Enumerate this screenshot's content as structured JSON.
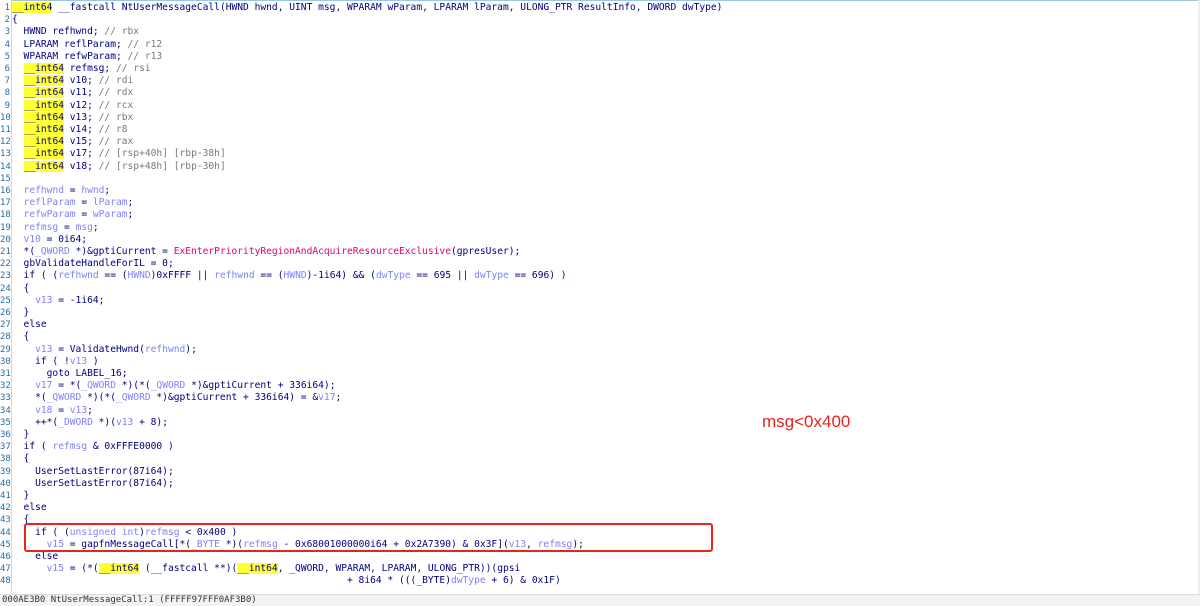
{
  "annotation": "msg<0x400",
  "status_bar": "000AE3B0 NtUserMessageCall:1 (FFFFF97FFF0AF3B0)",
  "lines": [
    {
      "n": "1",
      "seg": [
        [
          "hl",
          "__int64"
        ],
        [
          "kw",
          " __fastcall NtUserMessageCall(HWND hwnd, UINT msg, WPARAM wParam, LPARAM lParam, ULONG_PTR ResultInfo, DWORD dwType)"
        ]
      ]
    },
    {
      "n": "2",
      "seg": [
        [
          "kw",
          "{"
        ]
      ]
    },
    {
      "n": "3",
      "seg": [
        [
          "kw",
          "  HWND refhwnd; "
        ],
        [
          "comment",
          "// rbx"
        ]
      ]
    },
    {
      "n": "4",
      "seg": [
        [
          "kw",
          "  LPARAM reflParam; "
        ],
        [
          "comment",
          "// r12"
        ]
      ]
    },
    {
      "n": "5",
      "seg": [
        [
          "kw",
          "  WPARAM refwParam; "
        ],
        [
          "comment",
          "// r13"
        ]
      ]
    },
    {
      "n": "6",
      "seg": [
        [
          "kw",
          "  "
        ],
        [
          "hl",
          "__int64"
        ],
        [
          "kw",
          " refmsg; "
        ],
        [
          "comment",
          "// rsi"
        ]
      ]
    },
    {
      "n": "7",
      "seg": [
        [
          "kw",
          "  "
        ],
        [
          "hl",
          "__int64"
        ],
        [
          "kw",
          " v10; "
        ],
        [
          "comment",
          "// rdi"
        ]
      ]
    },
    {
      "n": "8",
      "seg": [
        [
          "kw",
          "  "
        ],
        [
          "hl",
          "__int64"
        ],
        [
          "kw",
          " v11; "
        ],
        [
          "comment",
          "// rdx"
        ]
      ]
    },
    {
      "n": "9",
      "seg": [
        [
          "kw",
          "  "
        ],
        [
          "hl",
          "__int64"
        ],
        [
          "kw",
          " v12; "
        ],
        [
          "comment",
          "// rcx"
        ]
      ]
    },
    {
      "n": "10",
      "seg": [
        [
          "kw",
          "  "
        ],
        [
          "hl",
          "__int64"
        ],
        [
          "kw",
          " v13; "
        ],
        [
          "comment",
          "// rbx"
        ]
      ]
    },
    {
      "n": "11",
      "seg": [
        [
          "kw",
          "  "
        ],
        [
          "hl",
          "__int64"
        ],
        [
          "kw",
          " v14; "
        ],
        [
          "comment",
          "// r8"
        ]
      ]
    },
    {
      "n": "12",
      "seg": [
        [
          "kw",
          "  "
        ],
        [
          "hl",
          "__int64"
        ],
        [
          "kw",
          " v15; "
        ],
        [
          "comment",
          "// rax"
        ]
      ]
    },
    {
      "n": "13",
      "seg": [
        [
          "kw",
          "  "
        ],
        [
          "hl",
          "__int64"
        ],
        [
          "kw",
          " v17; "
        ],
        [
          "comment",
          "// [rsp+40h] [rbp-38h]"
        ]
      ]
    },
    {
      "n": "14",
      "seg": [
        [
          "kw",
          "  "
        ],
        [
          "hl",
          "__int64"
        ],
        [
          "kw",
          " v18; "
        ],
        [
          "comment",
          "// [rsp+48h] [rbp-30h]"
        ]
      ]
    },
    {
      "n": "15",
      "seg": []
    },
    {
      "n": "16",
      "seg": [
        [
          "var",
          "  refhwnd"
        ],
        [
          "kw",
          " = "
        ],
        [
          "var",
          "hwnd"
        ],
        [
          "kw",
          ";"
        ]
      ]
    },
    {
      "n": "17",
      "seg": [
        [
          "var",
          "  reflParam"
        ],
        [
          "kw",
          " = "
        ],
        [
          "var",
          "lParam"
        ],
        [
          "kw",
          ";"
        ]
      ]
    },
    {
      "n": "18",
      "seg": [
        [
          "var",
          "  refwParam"
        ],
        [
          "kw",
          " = "
        ],
        [
          "var",
          "wParam"
        ],
        [
          "kw",
          ";"
        ]
      ]
    },
    {
      "n": "19",
      "seg": [
        [
          "var",
          "  refmsg"
        ],
        [
          "kw",
          " = "
        ],
        [
          "var",
          "msg"
        ],
        [
          "kw",
          ";"
        ]
      ]
    },
    {
      "n": "20",
      "seg": [
        [
          "var",
          "  v10"
        ],
        [
          "kw",
          " = 0i64;"
        ]
      ]
    },
    {
      "n": "21",
      "seg": [
        [
          "kw",
          "  *("
        ],
        [
          "var",
          "_QWORD"
        ],
        [
          "kw",
          " *)&gptiCurrent = "
        ],
        [
          "func",
          "ExEnterPriorityRegionAndAcquireResourceExclusive"
        ],
        [
          "kw",
          "(gpresUser);"
        ]
      ]
    },
    {
      "n": "22",
      "seg": [
        [
          "kw",
          "  gbValidateHandleForIL = 0;"
        ]
      ]
    },
    {
      "n": "23",
      "seg": [
        [
          "kw",
          "  if ( ("
        ],
        [
          "var",
          "refhwnd"
        ],
        [
          "kw",
          " == ("
        ],
        [
          "var",
          "HWND"
        ],
        [
          "kw",
          ")0xFFFF || "
        ],
        [
          "var",
          "refhwnd"
        ],
        [
          "kw",
          " == ("
        ],
        [
          "var",
          "HWND"
        ],
        [
          "kw",
          ")-1i64) && ("
        ],
        [
          "var",
          "dwType"
        ],
        [
          "kw",
          " == 695 || "
        ],
        [
          "var",
          "dwType"
        ],
        [
          "kw",
          " == 696) )"
        ]
      ]
    },
    {
      "n": "24",
      "seg": [
        [
          "kw",
          "  {"
        ]
      ]
    },
    {
      "n": "25",
      "seg": [
        [
          "var",
          "    v13"
        ],
        [
          "kw",
          " = -1i64;"
        ]
      ]
    },
    {
      "n": "26",
      "seg": [
        [
          "kw",
          "  }"
        ]
      ]
    },
    {
      "n": "27",
      "seg": [
        [
          "kw",
          "  else"
        ]
      ]
    },
    {
      "n": "28",
      "seg": [
        [
          "kw",
          "  {"
        ]
      ]
    },
    {
      "n": "29",
      "seg": [
        [
          "var",
          "    v13"
        ],
        [
          "kw",
          " = ValidateHwnd("
        ],
        [
          "var",
          "refhwnd"
        ],
        [
          "kw",
          ");"
        ]
      ]
    },
    {
      "n": "30",
      "seg": [
        [
          "kw",
          "    if ( !"
        ],
        [
          "var",
          "v13"
        ],
        [
          "kw",
          " )"
        ]
      ]
    },
    {
      "n": "31",
      "seg": [
        [
          "kw",
          "      goto LABEL_16;"
        ]
      ]
    },
    {
      "n": "32",
      "seg": [
        [
          "var",
          "    v17"
        ],
        [
          "kw",
          " = *("
        ],
        [
          "var",
          "_QWORD"
        ],
        [
          "kw",
          " *)(*("
        ],
        [
          "var",
          "_QWORD"
        ],
        [
          "kw",
          " *)&gptiCurrent + 336i64);"
        ]
      ]
    },
    {
      "n": "33",
      "seg": [
        [
          "kw",
          "    *("
        ],
        [
          "var",
          "_QWORD"
        ],
        [
          "kw",
          " *)(*("
        ],
        [
          "var",
          "_QWORD"
        ],
        [
          "kw",
          " *)&gptiCurrent + 336i64) = &"
        ],
        [
          "var",
          "v17"
        ],
        [
          "kw",
          ";"
        ]
      ]
    },
    {
      "n": "34",
      "seg": [
        [
          "var",
          "    v18"
        ],
        [
          "kw",
          " = "
        ],
        [
          "var",
          "v13"
        ],
        [
          "kw",
          ";"
        ]
      ]
    },
    {
      "n": "35",
      "seg": [
        [
          "kw",
          "    ++*("
        ],
        [
          "var",
          "_DWORD"
        ],
        [
          "kw",
          " *)("
        ],
        [
          "var",
          "v13"
        ],
        [
          "kw",
          " + 8);"
        ]
      ]
    },
    {
      "n": "36",
      "seg": [
        [
          "kw",
          "  }"
        ]
      ]
    },
    {
      "n": "37",
      "seg": [
        [
          "kw",
          "  if ( "
        ],
        [
          "var",
          "refmsg"
        ],
        [
          "kw",
          " & 0xFFFE0000 )"
        ]
      ]
    },
    {
      "n": "38",
      "seg": [
        [
          "kw",
          "  {"
        ]
      ]
    },
    {
      "n": "39",
      "seg": [
        [
          "kw",
          "    UserSetLastError(87i64);"
        ]
      ]
    },
    {
      "n": "40",
      "seg": [
        [
          "kw",
          "    UserSetLastError(87i64);"
        ]
      ]
    },
    {
      "n": "41",
      "seg": [
        [
          "kw",
          "  }"
        ]
      ]
    },
    {
      "n": "42",
      "seg": [
        [
          "kw",
          "  else"
        ]
      ]
    },
    {
      "n": "43",
      "seg": [
        [
          "kw",
          "  {"
        ]
      ]
    },
    {
      "n": "44",
      "seg": [
        [
          "kw",
          "    if ( ("
        ],
        [
          "var",
          "unsigned int"
        ],
        [
          "kw",
          ")"
        ],
        [
          "var",
          "refmsg"
        ],
        [
          "kw",
          " < 0x400 )"
        ]
      ]
    },
    {
      "n": "45",
      "seg": [
        [
          "var",
          "      v15"
        ],
        [
          "kw",
          " = gapfnMessageCall[*("
        ],
        [
          "var",
          "_BYTE"
        ],
        [
          "kw",
          " *)("
        ],
        [
          "var",
          "refmsg"
        ],
        [
          "kw",
          " - 0x68001000000i64 + 0x2A7390) & 0x3F]("
        ],
        [
          "var",
          "v13"
        ],
        [
          "kw",
          ", "
        ],
        [
          "var",
          "refmsg"
        ],
        [
          "kw",
          ");"
        ]
      ]
    },
    {
      "n": "46",
      "seg": [
        [
          "kw",
          "    else"
        ]
      ]
    },
    {
      "n": "47",
      "seg": [
        [
          "var",
          "      v15"
        ],
        [
          "kw",
          " = (*("
        ],
        [
          "hl",
          "__int64"
        ],
        [
          "kw",
          " (__fastcall **)("
        ],
        [
          "hl",
          "__int64"
        ],
        [
          "kw",
          ", _QWORD, WPARAM, LPARAM, ULONG_PTR))(gpsi"
        ]
      ]
    },
    {
      "n": "48",
      "seg": [
        [
          "kw",
          "                                                          + 8i64 * (((_BYTE)"
        ],
        [
          "var",
          "dwType"
        ],
        [
          "kw",
          " + 6) & 0x1F)"
        ]
      ]
    }
  ]
}
